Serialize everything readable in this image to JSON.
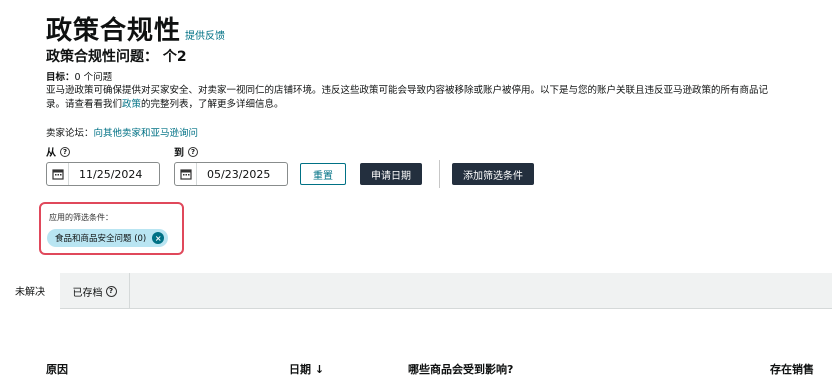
{
  "header": {
    "title": "政策合规性",
    "feedback_link": "提供反馈",
    "issue_count": "政策合规性问题： 个2"
  },
  "target": {
    "label": "目标：",
    "value": "0 个问题"
  },
  "description": {
    "text_before": "亚马逊政策可确保提供对买家安全、对卖家一视同仁的店铺环境。违反这些政策可能会导致内容被移除或账户被停用。以下是与您的账户关联且违反亚马逊政策的所有商品记录。请查看看我们",
    "link": "政策",
    "text_after": "的完整列表，了解更多详细信息。"
  },
  "forum": {
    "label": "卖家论坛：",
    "link": "向其他卖家和亚马逊询问"
  },
  "date_from": {
    "label": "从",
    "value": "11/25/2024"
  },
  "date_to": {
    "label": "到",
    "value": "05/23/2025"
  },
  "buttons": {
    "reset": "重置",
    "apply_date": "申请日期",
    "add_filter": "添加筛选条件"
  },
  "filters": {
    "label": "应用的筛选条件：",
    "chips": [
      {
        "label": "食品和商品安全问题 (0)"
      }
    ]
  },
  "tabs": [
    {
      "label": "未解决",
      "active": true
    },
    {
      "label": "已存档",
      "active": false
    }
  ],
  "table": {
    "columns": [
      {
        "label": "原因"
      },
      {
        "label": "日期 ↓"
      },
      {
        "label": "哪些商品会受到影响?"
      },
      {
        "label": "存在销售"
      }
    ]
  },
  "colors": {
    "link": "#007185",
    "dark_button": "#232f3e",
    "chip_bg": "#b9e5f2",
    "highlight_border": "#e0485b"
  }
}
